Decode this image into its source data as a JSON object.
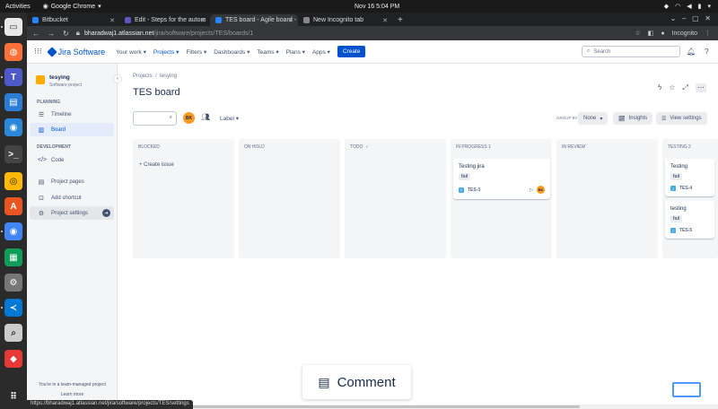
{
  "os": {
    "activities": "Activities",
    "app_name": "Google Chrome",
    "clock": "Nov 16  5:04 PM"
  },
  "browser": {
    "tabs": [
      {
        "title": "Bitbucket",
        "color": "#2684ff"
      },
      {
        "title": "Edit - Steps for the autom",
        "color": "#6554c0"
      },
      {
        "title": "TES board - Agile board - ",
        "color": "#0052cc"
      },
      {
        "title": "New Incognito tab",
        "color": "#888888"
      }
    ],
    "url_host": "bharadwaj1.atlassian.net",
    "url_path": "/jira/software/projects/TES/boards/1",
    "incognito_label": "Incognito"
  },
  "header": {
    "product": "Jira Software",
    "menus": [
      "Your work",
      "Projects",
      "Filters",
      "Dashboards",
      "Teams",
      "Plans",
      "Apps"
    ],
    "create": "Create",
    "search_placeholder": "Search",
    "user_initials": "BK"
  },
  "sidebar": {
    "project_name": "tesying",
    "project_type": "Software project",
    "planning_label": "PLANNING",
    "development_label": "DEVELOPMENT",
    "timeline": "Timeline",
    "board": "Board",
    "code": "Code",
    "project_pages": "Project pages",
    "add_shortcut": "Add shortcut",
    "project_settings": "Project settings",
    "footer_text": "You're in a team-managed project",
    "learn_more": "Learn more"
  },
  "board": {
    "breadcrumb_projects": "Projects",
    "breadcrumb_project": "tesying",
    "title": "TES board",
    "label_filter": "Label",
    "group_by": "GROUP BY",
    "group_value": "None",
    "insights": "Insights",
    "view_settings": "View settings",
    "create_issue": "+ Create issue",
    "columns": [
      "BLOCKED",
      "ON HOLD",
      "TODO",
      "IN PROGRESS 1",
      "IN REVIEW",
      "TESTING 2"
    ],
    "cards": {
      "c1": {
        "title": "Testing jira",
        "tag": "fail",
        "key": "TES-3"
      },
      "c2": {
        "title": "Testing",
        "tag": "fail",
        "key": "TES-4"
      },
      "c3": {
        "title": "testing",
        "tag": "fail",
        "key": "TES-5"
      }
    }
  },
  "comment": "Comment",
  "status_url": "https://bharadwaj1.atlassian.net/jira/software/projects/TES/settings"
}
